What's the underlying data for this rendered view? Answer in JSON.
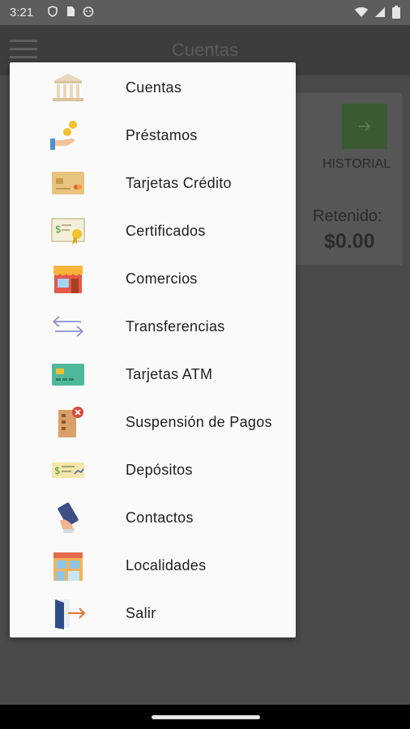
{
  "status_bar": {
    "time": "3:21"
  },
  "app_bar": {
    "title": "Cuentas"
  },
  "background_card": {
    "history_label": "HISTORIAL",
    "retained_label": "Retenido:",
    "retained_value": "$0.00"
  },
  "menu": {
    "items": [
      {
        "label": "Cuentas",
        "icon": "bank-icon"
      },
      {
        "label": "Préstamos",
        "icon": "loan-hand-coins-icon"
      },
      {
        "label": "Tarjetas Crédito",
        "icon": "credit-card-icon"
      },
      {
        "label": "Certificados",
        "icon": "certificate-icon"
      },
      {
        "label": "Comercios",
        "icon": "store-icon"
      },
      {
        "label": "Transferencias",
        "icon": "transfer-arrows-icon"
      },
      {
        "label": "Tarjetas ATM",
        "icon": "atm-card-icon"
      },
      {
        "label": "Suspensión de Pagos",
        "icon": "payment-suspension-icon"
      },
      {
        "label": "Depósitos",
        "icon": "deposit-check-icon"
      },
      {
        "label": "Contactos",
        "icon": "contact-phone-icon"
      },
      {
        "label": "Localidades",
        "icon": "branch-building-icon"
      },
      {
        "label": "Salir",
        "icon": "exit-door-icon"
      }
    ]
  }
}
